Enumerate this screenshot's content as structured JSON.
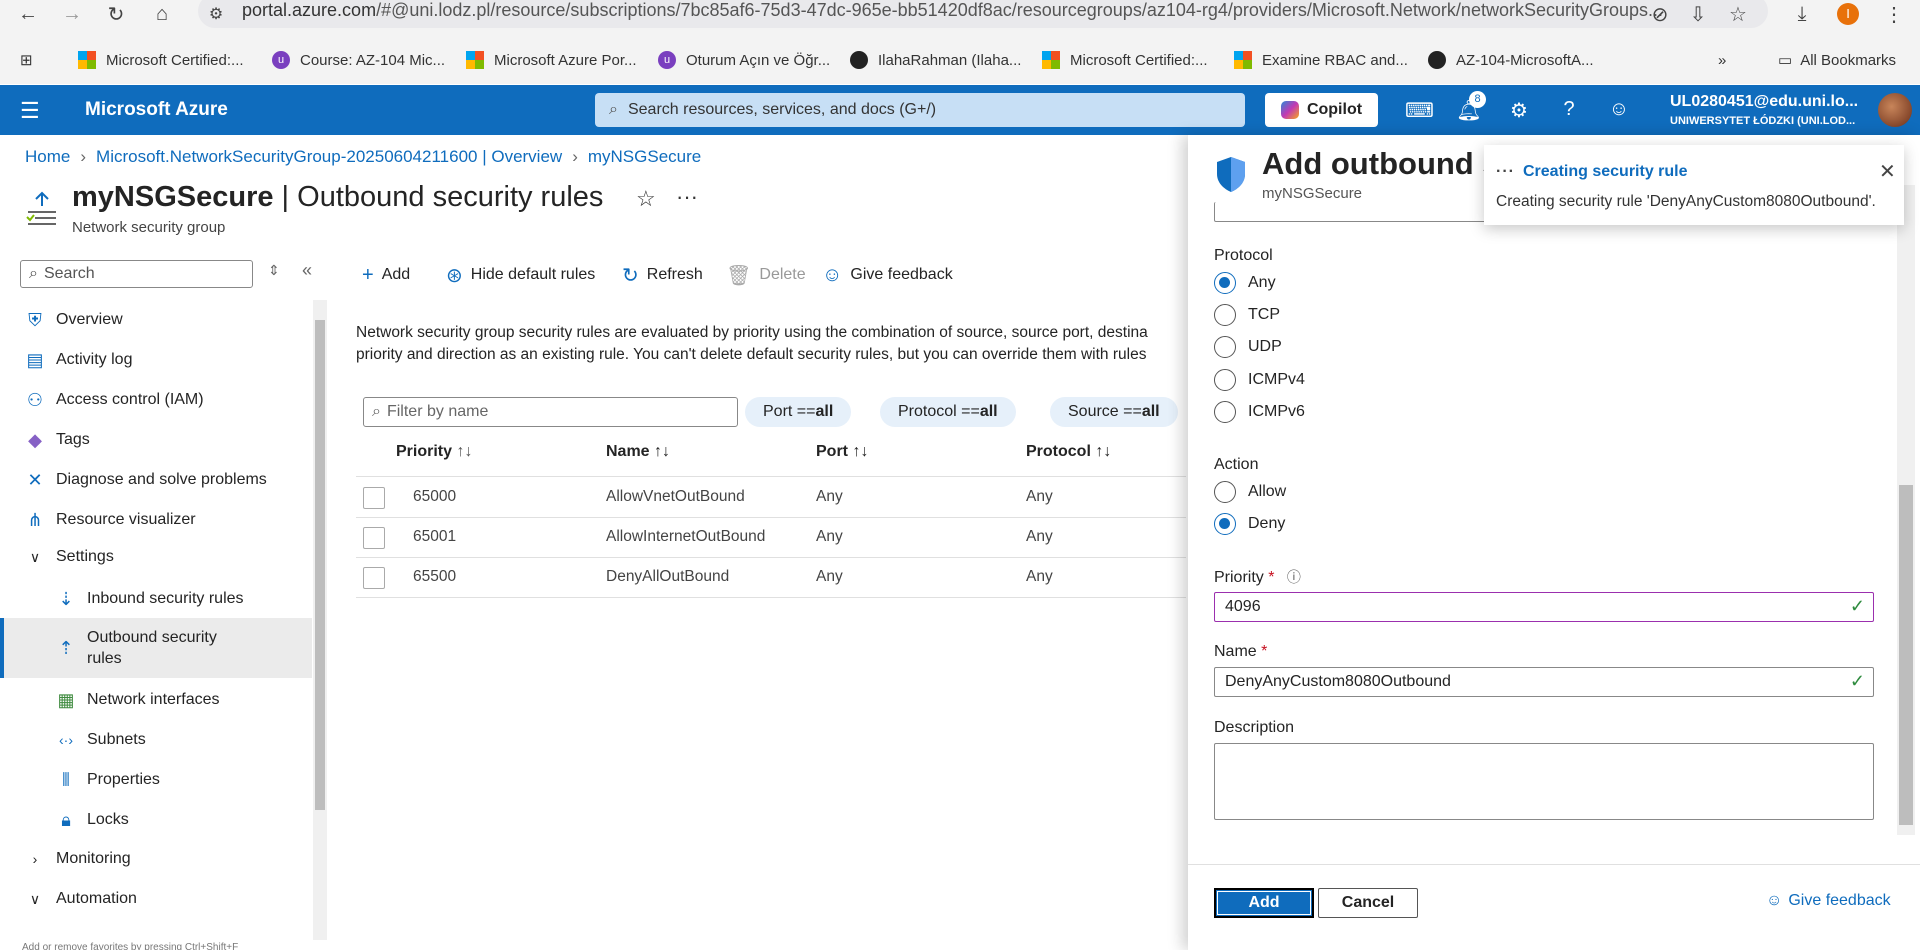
{
  "browser": {
    "url_prefix": "portal.azure.com",
    "url_rest": "/#@uni.lodz.pl/resource/subscriptions/7bc85af6-75d3-47dc-965e-bb51420df8ac/resourcegroups/az104-rg4/providers/Microsoft.Network/networkSecurityGroups...",
    "profile_initial": "I",
    "bookmarks": [
      "Microsoft Certified:...",
      "Course: AZ-104 Mic...",
      "Microsoft Azure Por...",
      "Oturum Açın ve Öğr...",
      "IlahaRahman (Ilaha...",
      "Microsoft Certified:...",
      "Examine RBAC and...",
      "AZ-104-MicrosoftA..."
    ],
    "all_bookmarks": "All Bookmarks"
  },
  "header": {
    "brand": "Microsoft Azure",
    "search_placeholder": "Search resources, services, and docs (G+/)",
    "copilot": "Copilot",
    "notification_count": "8",
    "user_name": "UL0280451@edu.uni.lo...",
    "user_org": "UNIWERSYTET ŁÓDZKI (UNI.LOD..."
  },
  "breadcrumb": {
    "home": "Home",
    "nsg_overview": "Microsoft.NetworkSecurityGroup-20250604211600 | Overview",
    "nsg": "myNSGSecure"
  },
  "page": {
    "title_name": "myNSGSecure",
    "title_section": " | Outbound security rules",
    "subtitle": "Network security group"
  },
  "sidebar": {
    "search_placeholder": "Search",
    "items": [
      {
        "label": "Overview"
      },
      {
        "label": "Activity log"
      },
      {
        "label": "Access control (IAM)"
      },
      {
        "label": "Tags"
      },
      {
        "label": "Diagnose and solve problems"
      },
      {
        "label": "Resource visualizer"
      },
      {
        "label": "Settings"
      },
      {
        "label": "Inbound security rules"
      },
      {
        "label": "Outbound security rules"
      },
      {
        "label": "Network interfaces"
      },
      {
        "label": "Subnets"
      },
      {
        "label": "Properties"
      },
      {
        "label": "Locks"
      },
      {
        "label": "Monitoring"
      },
      {
        "label": "Automation"
      }
    ],
    "status_hint": "Add or remove favorites by pressing Ctrl+Shift+F"
  },
  "toolbar": {
    "add": "Add",
    "hide_default": "Hide default rules",
    "refresh": "Refresh",
    "delete": "Delete",
    "feedback": "Give feedback"
  },
  "main": {
    "info_line1": "Network security group security rules are evaluated by priority using the combination of source, source port, destina",
    "info_line2": "priority and direction as an existing rule. You can't delete default security rules, but you can override them with rules",
    "filter_placeholder": "Filter by name",
    "pills": [
      {
        "key": "Port == ",
        "val": "all"
      },
      {
        "key": "Protocol == ",
        "val": "all"
      },
      {
        "key": "Source == ",
        "val": "all"
      }
    ],
    "columns": [
      "Priority",
      "Name",
      "Port",
      "Protocol"
    ],
    "rows": [
      {
        "priority": "65000",
        "name": "AllowVnetOutBound",
        "port": "Any",
        "protocol": "Any"
      },
      {
        "priority": "65001",
        "name": "AllowInternetOutBound",
        "port": "Any",
        "protocol": "Any"
      },
      {
        "priority": "65500",
        "name": "DenyAllOutBound",
        "port": "Any",
        "protocol": "Any"
      }
    ]
  },
  "panel": {
    "title": "Add outbound s",
    "subtitle": "myNSGSecure",
    "protocol_label": "Protocol",
    "protocols": [
      "Any",
      "TCP",
      "UDP",
      "ICMPv4",
      "ICMPv6"
    ],
    "protocol_selected": "Any",
    "action_label": "Action",
    "actions": [
      "Allow",
      "Deny"
    ],
    "action_selected": "Deny",
    "priority_label": "Priority",
    "priority_value": "4096",
    "name_label": "Name",
    "name_value": "DenyAnyCustom8080Outbound",
    "description_label": "Description",
    "description_value": "",
    "add_button": "Add",
    "cancel_button": "Cancel",
    "feedback": "Give feedback"
  },
  "toast": {
    "title": "Creating security rule",
    "message": "Creating security rule 'DenyAnyCustom8080Outbound'."
  }
}
